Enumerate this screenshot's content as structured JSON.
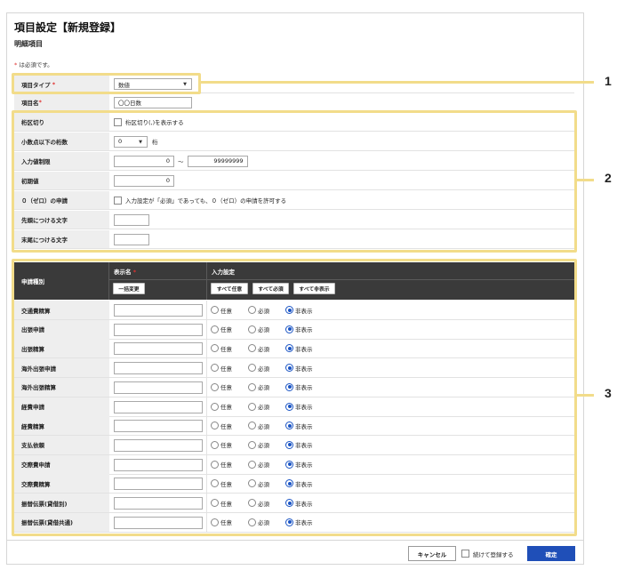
{
  "page": {
    "title": "項目設定【新規登録】",
    "subtitle": "明細項目",
    "required_mark": "*",
    "required_note": " は必須です。"
  },
  "callouts": [
    "1",
    "2",
    "3"
  ],
  "form": {
    "item_type": {
      "label": "項目タイプ",
      "value": "数値"
    },
    "item_name": {
      "label": "項目名",
      "value": "〇〇日数"
    },
    "digit_separator": {
      "label": "桁区切り",
      "option": "桁区切り(,)を表示する"
    },
    "decimal_places": {
      "label": "小数点以下の桁数",
      "value": "0",
      "unit": "桁"
    },
    "input_limit": {
      "label": "入力値制限",
      "min": "0",
      "tilde": "〜",
      "max": "99999999"
    },
    "initial_value": {
      "label": "初期値",
      "value": "0"
    },
    "zero_request": {
      "label": "０（ゼロ）の申請",
      "option": "入力設定が「必須」であっても、０（ゼロ）の申請を許可する"
    },
    "prefix": {
      "label": "先頭につける文字",
      "value": ""
    },
    "suffix": {
      "label": "末尾につける文字",
      "value": ""
    }
  },
  "table": {
    "col_type": "申請種別",
    "col_name": "表示名",
    "col_input": "入力設定",
    "bulk_change": "一括変更",
    "all_optional": "すべて任意",
    "all_required": "すべて必須",
    "all_hidden": "すべて非表示",
    "radio_labels": {
      "optional": "任意",
      "required": "必須",
      "hidden": "非表示"
    },
    "rows": [
      {
        "label": "交通費精算",
        "selected": "hidden"
      },
      {
        "label": "出張申請",
        "selected": "hidden"
      },
      {
        "label": "出張精算",
        "selected": "hidden"
      },
      {
        "label": "海外出張申請",
        "selected": "hidden"
      },
      {
        "label": "海外出張精算",
        "selected": "hidden"
      },
      {
        "label": "経費申請",
        "selected": "hidden"
      },
      {
        "label": "経費精算",
        "selected": "hidden"
      },
      {
        "label": "支払依頼",
        "selected": "hidden"
      },
      {
        "label": "交際費申請",
        "selected": "hidden"
      },
      {
        "label": "交際費精算",
        "selected": "hidden"
      },
      {
        "label": "振替伝票(貸借別)",
        "selected": "hidden"
      },
      {
        "label": "振替伝票(貸借共通)",
        "selected": "hidden"
      }
    ]
  },
  "footer": {
    "cancel": "キャンセル",
    "continue": "続けて登録する",
    "confirm": "確定"
  },
  "colors": {
    "highlight": "#f2dc8a",
    "primary": "#1f4fb8",
    "required": "#e0302f"
  }
}
